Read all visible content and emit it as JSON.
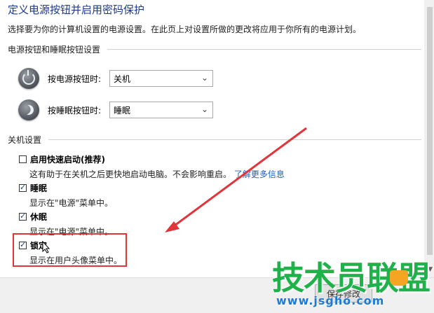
{
  "page": {
    "title": "定义电源按钮并启用密码保护",
    "description": "选择要为你的计算机设置的电源设置。在此页上对设置所做的更改将应用于你所有的电源计划。"
  },
  "power_section": {
    "heading": "电源按钮和睡眠按钮设置",
    "power_button": {
      "label": "按电源按钮时:",
      "value": "关机"
    },
    "sleep_button": {
      "label": "按睡眠按钮时:",
      "value": "睡眠"
    }
  },
  "shutdown_section": {
    "heading": "关机设置",
    "options": [
      {
        "label": "启用快速启动(推荐)",
        "checked": false,
        "desc": "这有助于在关机之后更快地启动电脑。不会影响重启。",
        "link": "了解更多信息"
      },
      {
        "label": "睡眠",
        "checked": true,
        "desc": "显示在\"电源\"菜单中。"
      },
      {
        "label": "休眠",
        "checked": true,
        "desc": "显示在\"电源\"菜单中。"
      },
      {
        "label": "锁定",
        "checked": true,
        "desc": "显示在用户头像菜单中。"
      }
    ]
  },
  "footer": {
    "save_label": "保存修改"
  },
  "watermark": {
    "brand": "技术员联盟",
    "url": "www.jsgho.com"
  },
  "colors": {
    "title": "#1e3a8a",
    "highlight": "#e0353a",
    "watermark_green": "#1fb14a",
    "watermark_blue": "#1e7ad6"
  }
}
